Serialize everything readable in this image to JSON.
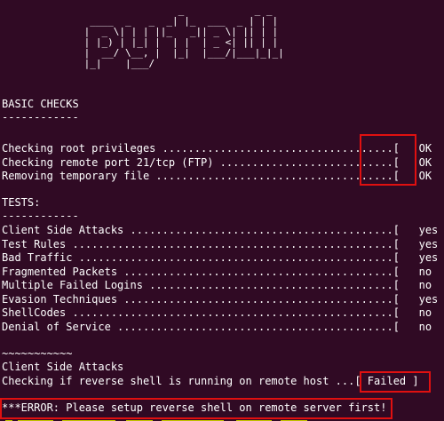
{
  "banner": {
    "ascii": "                 _            _ _ \n  ____  _   _  _| |_  ___  _ | | |\n |  _ \\| | | ||_   _|| _ \\| || | |\n | |_) | |_| |  | |  | _ <| || | |\n |  __/ \\__, |  |_|  |___/|___|_|_|\n |_|    |___/                      "
  },
  "basic": {
    "heading": "BASIC CHECKS",
    "rule": "------------",
    "rows": [
      "Checking root privileges ....................................[   OK   ]",
      "Checking remote port 21/tcp (FTP) ...........................[   OK   ]",
      "Removing temporary file .....................................[   OK   ]"
    ]
  },
  "tests": {
    "heading": "TESTS:",
    "rule": "------------",
    "rows": [
      "Client Side Attacks .........................................[   yes  ]",
      "Test Rules ..................................................[   yes  ]",
      "Bad Traffic .................................................[   yes  ]",
      "Fragmented Packets ..........................................[   no   ]",
      "Multiple Failed Logins ......................................[   no   ]",
      "Evasion Techniques ..........................................[   yes  ]",
      "ShellCodes ..................................................[   no   ]",
      "Denial of Service ...........................................[   no   ]"
    ]
  },
  "run": {
    "rule": "~~~~~~~~~~~",
    "section": "Client Side Attacks",
    "check": "Checking if reverse shell is running on remote host ...[ Failed ]"
  },
  "error": {
    "text": "***ERROR: Please setup reverse shell on remote server first!"
  },
  "colors": {
    "background": "#300a24",
    "highlight": "#e01010"
  }
}
